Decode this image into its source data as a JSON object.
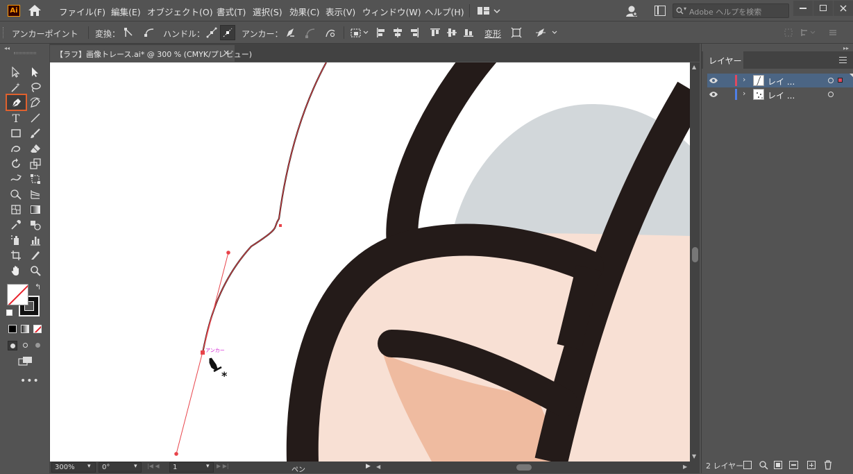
{
  "app": {
    "logo": "Ai"
  },
  "menu": [
    "ファイル(F)",
    "編集(E)",
    "オブジェクト(O)",
    "書式(T)",
    "選択(S)",
    "効果(C)",
    "表示(V)",
    "ウィンドウ(W)",
    "ヘルプ(H)"
  ],
  "search": {
    "placeholder": "Adobe ヘルプを検索"
  },
  "control": {
    "mode": "アンカーポイント",
    "convert": "変換：",
    "handles": "ハンドル：",
    "anchors": "アンカー：",
    "transform": "変形"
  },
  "document": {
    "tab_title": "【ラフ】画像トレース.ai* @ 300 % (CMYK/プレビュー)",
    "close": "×"
  },
  "canvas": {
    "anchor_label": "アンカー",
    "cursor_mark": "*"
  },
  "status": {
    "zoom": "300%",
    "rotation": "0°",
    "artboard": "1",
    "tool": "ペン"
  },
  "layers_panel": {
    "tab": "レイヤー",
    "layers": [
      {
        "name": "レイ ...",
        "color": "#e0495f",
        "selected": true
      },
      {
        "name": "レイ ...",
        "color": "#4f7fe6",
        "selected": false
      }
    ],
    "footer_count": "2 レイヤー"
  },
  "colors": {
    "accent_tool_highlight": "#e0612e",
    "path_red": "#e8434a",
    "skin_light": "#f8e0d4",
    "skin_dark": "#efbba0",
    "outline": "#241b19",
    "gray_shape": "#d2d7da"
  }
}
